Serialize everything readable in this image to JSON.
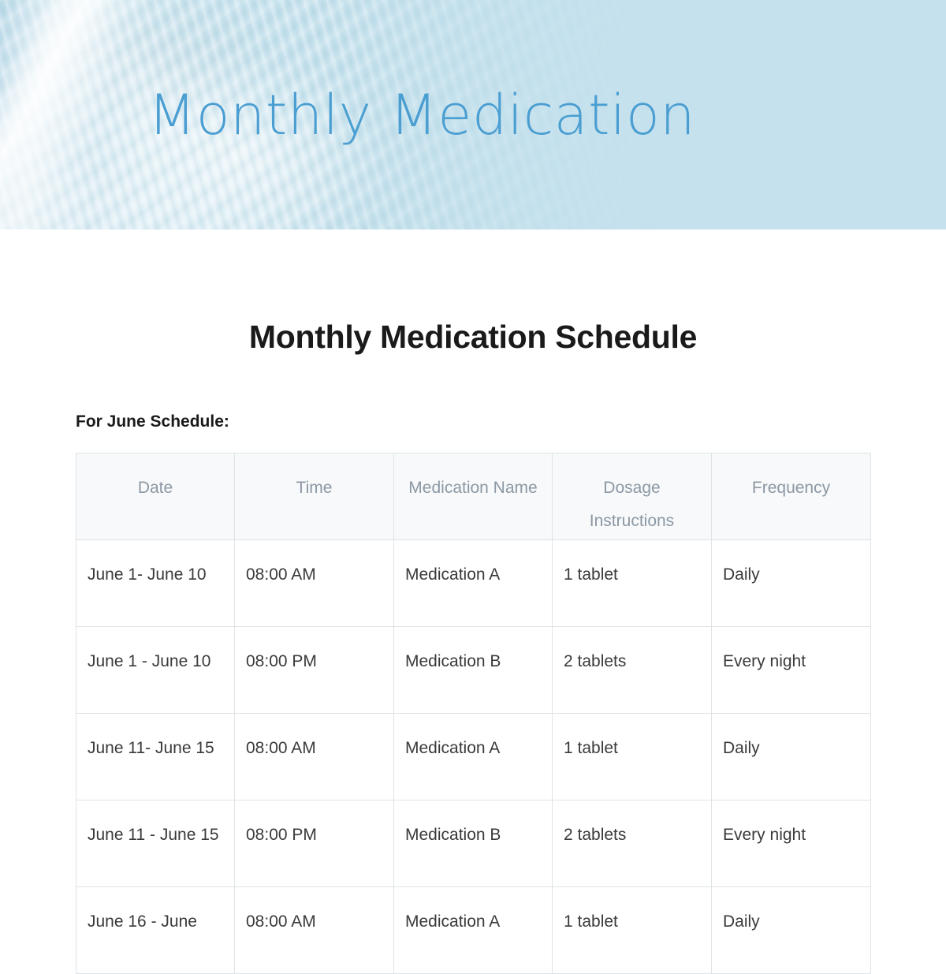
{
  "banner": {
    "title": "Monthly Medication",
    "title_color": "#4a9ed1",
    "background_color": "#c4e1ec",
    "image_name": "water-ripple-photo"
  },
  "document": {
    "page_title": "Monthly Medication Schedule",
    "subheading": "For June Schedule:"
  },
  "table": {
    "columns": [
      "Date",
      "Time",
      "Medication Name",
      "Dosage Instructions",
      "Frequency"
    ],
    "header_text_color": "#8c98a4",
    "header_background": "#f7f9fa",
    "border_color": "#dfe3e6",
    "rows": [
      {
        "date": "June 1- June 10",
        "time": "08:00 AM",
        "medication": "Medication A",
        "dosage": "1 tablet",
        "frequency": "Daily"
      },
      {
        "date": "June 1 - June 10",
        "time": "08:00 PM",
        "medication": "Medication B",
        "dosage": "2 tablets",
        "frequency": "Every night"
      },
      {
        "date": "June 11- June 15",
        "time": "08:00 AM",
        "medication": "Medication A",
        "dosage": "1 tablet",
        "frequency": "Daily"
      },
      {
        "date": "June 11 - June 15",
        "time": "08:00 PM",
        "medication": "Medication B",
        "dosage": "2 tablets",
        "frequency": "Every night"
      },
      {
        "date": "June 16 - June",
        "time": "08:00 AM",
        "medication": "Medication A",
        "dosage": "1 tablet",
        "frequency": "Daily"
      }
    ]
  }
}
